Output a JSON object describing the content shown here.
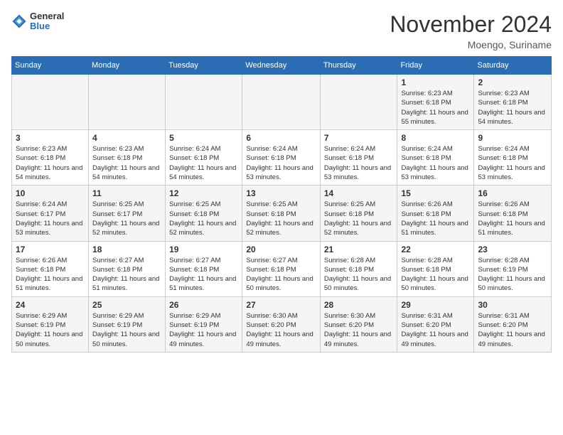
{
  "logo": {
    "general": "General",
    "blue": "Blue"
  },
  "header": {
    "title": "November 2024",
    "subtitle": "Moengo, Suriname"
  },
  "days_of_week": [
    "Sunday",
    "Monday",
    "Tuesday",
    "Wednesday",
    "Thursday",
    "Friday",
    "Saturday"
  ],
  "weeks": [
    [
      {
        "day": "",
        "info": ""
      },
      {
        "day": "",
        "info": ""
      },
      {
        "day": "",
        "info": ""
      },
      {
        "day": "",
        "info": ""
      },
      {
        "day": "",
        "info": ""
      },
      {
        "day": "1",
        "info": "Sunrise: 6:23 AM\nSunset: 6:18 PM\nDaylight: 11 hours and 55 minutes."
      },
      {
        "day": "2",
        "info": "Sunrise: 6:23 AM\nSunset: 6:18 PM\nDaylight: 11 hours and 54 minutes."
      }
    ],
    [
      {
        "day": "3",
        "info": "Sunrise: 6:23 AM\nSunset: 6:18 PM\nDaylight: 11 hours and 54 minutes."
      },
      {
        "day": "4",
        "info": "Sunrise: 6:23 AM\nSunset: 6:18 PM\nDaylight: 11 hours and 54 minutes."
      },
      {
        "day": "5",
        "info": "Sunrise: 6:24 AM\nSunset: 6:18 PM\nDaylight: 11 hours and 54 minutes."
      },
      {
        "day": "6",
        "info": "Sunrise: 6:24 AM\nSunset: 6:18 PM\nDaylight: 11 hours and 53 minutes."
      },
      {
        "day": "7",
        "info": "Sunrise: 6:24 AM\nSunset: 6:18 PM\nDaylight: 11 hours and 53 minutes."
      },
      {
        "day": "8",
        "info": "Sunrise: 6:24 AM\nSunset: 6:18 PM\nDaylight: 11 hours and 53 minutes."
      },
      {
        "day": "9",
        "info": "Sunrise: 6:24 AM\nSunset: 6:18 PM\nDaylight: 11 hours and 53 minutes."
      }
    ],
    [
      {
        "day": "10",
        "info": "Sunrise: 6:24 AM\nSunset: 6:17 PM\nDaylight: 11 hours and 53 minutes."
      },
      {
        "day": "11",
        "info": "Sunrise: 6:25 AM\nSunset: 6:17 PM\nDaylight: 11 hours and 52 minutes."
      },
      {
        "day": "12",
        "info": "Sunrise: 6:25 AM\nSunset: 6:18 PM\nDaylight: 11 hours and 52 minutes."
      },
      {
        "day": "13",
        "info": "Sunrise: 6:25 AM\nSunset: 6:18 PM\nDaylight: 11 hours and 52 minutes."
      },
      {
        "day": "14",
        "info": "Sunrise: 6:25 AM\nSunset: 6:18 PM\nDaylight: 11 hours and 52 minutes."
      },
      {
        "day": "15",
        "info": "Sunrise: 6:26 AM\nSunset: 6:18 PM\nDaylight: 11 hours and 51 minutes."
      },
      {
        "day": "16",
        "info": "Sunrise: 6:26 AM\nSunset: 6:18 PM\nDaylight: 11 hours and 51 minutes."
      }
    ],
    [
      {
        "day": "17",
        "info": "Sunrise: 6:26 AM\nSunset: 6:18 PM\nDaylight: 11 hours and 51 minutes."
      },
      {
        "day": "18",
        "info": "Sunrise: 6:27 AM\nSunset: 6:18 PM\nDaylight: 11 hours and 51 minutes."
      },
      {
        "day": "19",
        "info": "Sunrise: 6:27 AM\nSunset: 6:18 PM\nDaylight: 11 hours and 51 minutes."
      },
      {
        "day": "20",
        "info": "Sunrise: 6:27 AM\nSunset: 6:18 PM\nDaylight: 11 hours and 50 minutes."
      },
      {
        "day": "21",
        "info": "Sunrise: 6:28 AM\nSunset: 6:18 PM\nDaylight: 11 hours and 50 minutes."
      },
      {
        "day": "22",
        "info": "Sunrise: 6:28 AM\nSunset: 6:18 PM\nDaylight: 11 hours and 50 minutes."
      },
      {
        "day": "23",
        "info": "Sunrise: 6:28 AM\nSunset: 6:19 PM\nDaylight: 11 hours and 50 minutes."
      }
    ],
    [
      {
        "day": "24",
        "info": "Sunrise: 6:29 AM\nSunset: 6:19 PM\nDaylight: 11 hours and 50 minutes."
      },
      {
        "day": "25",
        "info": "Sunrise: 6:29 AM\nSunset: 6:19 PM\nDaylight: 11 hours and 50 minutes."
      },
      {
        "day": "26",
        "info": "Sunrise: 6:29 AM\nSunset: 6:19 PM\nDaylight: 11 hours and 49 minutes."
      },
      {
        "day": "27",
        "info": "Sunrise: 6:30 AM\nSunset: 6:20 PM\nDaylight: 11 hours and 49 minutes."
      },
      {
        "day": "28",
        "info": "Sunrise: 6:30 AM\nSunset: 6:20 PM\nDaylight: 11 hours and 49 minutes."
      },
      {
        "day": "29",
        "info": "Sunrise: 6:31 AM\nSunset: 6:20 PM\nDaylight: 11 hours and 49 minutes."
      },
      {
        "day": "30",
        "info": "Sunrise: 6:31 AM\nSunset: 6:20 PM\nDaylight: 11 hours and 49 minutes."
      }
    ]
  ]
}
